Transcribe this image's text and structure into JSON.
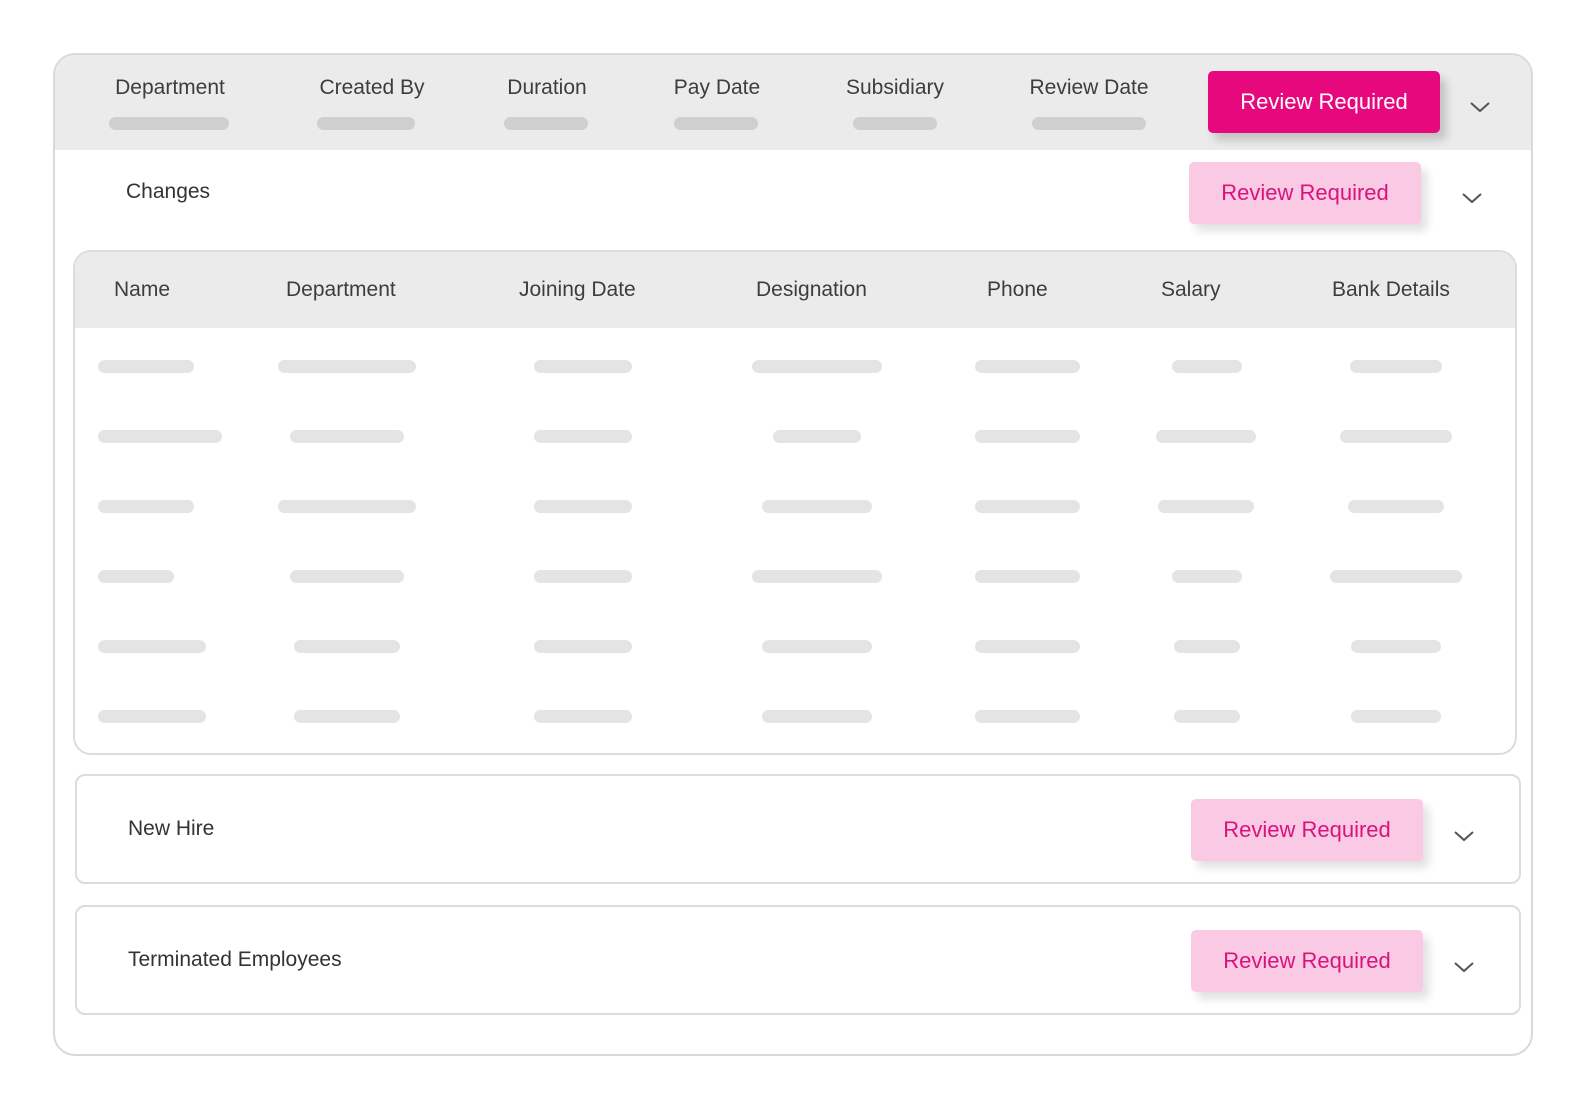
{
  "filters": [
    {
      "label": "Department"
    },
    {
      "label": "Created By"
    },
    {
      "label": "Duration"
    },
    {
      "label": "Pay Date"
    },
    {
      "label": "Subsidiary"
    },
    {
      "label": "Review Date"
    }
  ],
  "header_button": "Review Required",
  "sections": {
    "changes": {
      "label": "Changes",
      "button": "Review Required"
    },
    "new_hire": {
      "label": "New Hire",
      "button": "Review Required"
    },
    "terminated": {
      "label": "Terminated Employees",
      "button": "Review Required"
    }
  },
  "table": {
    "columns": [
      "Name",
      "Department",
      "Joining Date",
      "Designation",
      "Phone",
      "Salary",
      "Bank Details"
    ]
  },
  "colors": {
    "primary": "#e6087c",
    "primary_light": "#fac9e4",
    "primary_light_text": "#d8137e",
    "header_bg": "#ebebeb",
    "skeleton": "#e4e4e4"
  },
  "icons": {
    "expand": "chevron-down-icon"
  }
}
